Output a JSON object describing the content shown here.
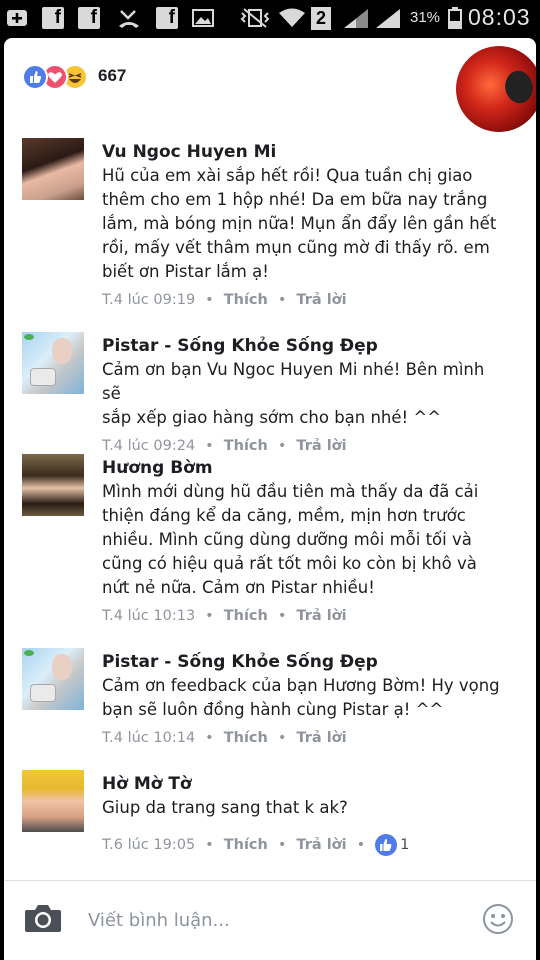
{
  "status_bar": {
    "sim": "2",
    "battery": "31%",
    "time": "08:03"
  },
  "reactions": {
    "count": "667",
    "types": [
      "like-icon",
      "love-icon",
      "haha-icon"
    ]
  },
  "comments": [
    {
      "name": "Vu Ngoc Huyen Mi",
      "text": "Hũ của em xài sắp hết rồi! Qua tuần chị giao\nthêm cho em 1 hộp nhé! Da em bữa nay trắng\nlắm, mà bóng mịn nữa! Mụn ẩn đẩy lên gần hết\nrồi, mấy vết thâm mụn cũng mờ đi thấy rõ. em\nbiết ơn Pistar lắm ạ!",
      "time": "T.4 lúc 09:19",
      "like": "Thích",
      "reply": "Trả lời"
    },
    {
      "name": "Pistar - Sống Khỏe Sống Đẹp",
      "text": "Cảm ơn bạn Vu Ngoc Huyen Mi nhé! Bên mình sẽ\nsắp xếp giao hàng sớm cho bạn nhé! ^^",
      "time": "T.4 lúc 09:24",
      "like": "Thích",
      "reply": "Trả lời"
    },
    {
      "name": "Hương Bờm",
      "text": "Mình mới dùng hũ đầu tiên mà thấy da đã cải\nthiện đáng kể da căng, mềm, mịn hơn trước\nnhiều. Mình cũng dùng dưỡng môi mỗi tối và\ncũng có hiệu quả rất tốt môi ko còn bị khô và\nnứt nẻ nữa. Cảm ơn Pistar nhiều!",
      "time": "T.4 lúc 10:13",
      "like": "Thích",
      "reply": "Trả lời"
    },
    {
      "name": "Pistar - Sống Khỏe Sống Đẹp",
      "text": "Cảm ơn feedback của bạn Hương Bờm! Hy vọng\nbạn sẽ luôn đồng hành cùng Pistar ạ! ^^",
      "time": "T.4 lúc 10:14",
      "like": "Thích",
      "reply": "Trả lời"
    },
    {
      "name": "Hờ Mờ Tờ",
      "text": "Giup da trang sang that k ak?",
      "time": "T.6 lúc 19:05",
      "like": "Thích",
      "reply": "Trả lời",
      "like_count": "1"
    }
  ],
  "composer": {
    "placeholder": "Viết bình luận..."
  },
  "colors": {
    "like_blue": "#4f7ce8",
    "love_red": "#f0506e",
    "haha_yellow": "#f7c533",
    "meta_gray": "#90949c"
  }
}
